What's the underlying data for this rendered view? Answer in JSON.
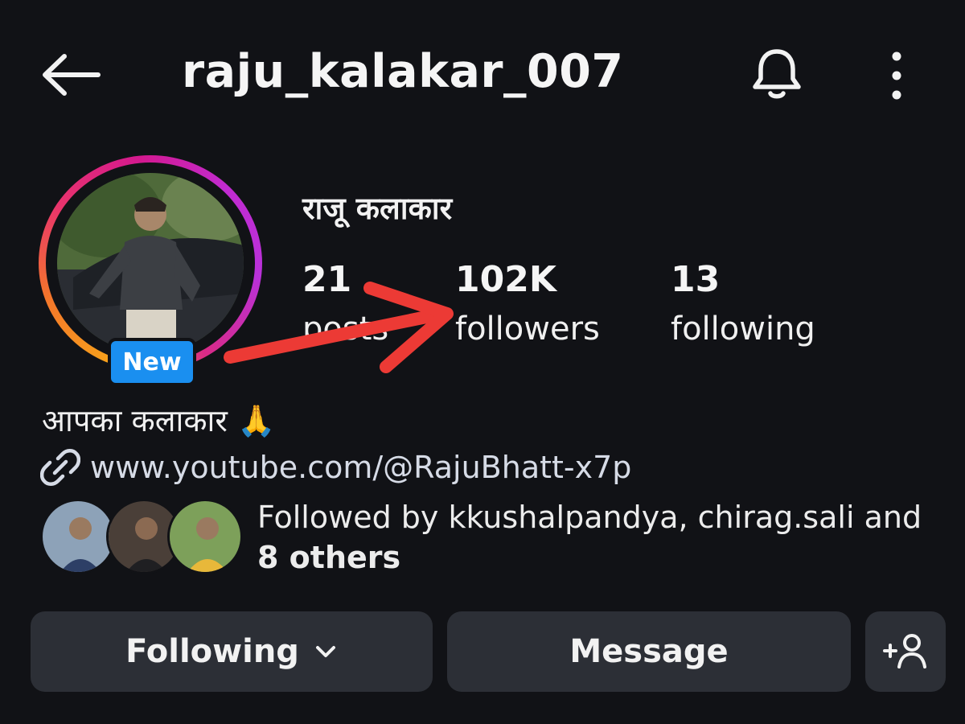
{
  "header": {
    "username": "raju_kalakar_007",
    "back_icon": "arrow-left-icon",
    "bell_icon": "bell-icon",
    "more_icon": "more-vertical-icon"
  },
  "profile": {
    "display_name": "राजू कलाकार",
    "badge": "New",
    "stats": {
      "posts": {
        "count": "21",
        "label": "posts"
      },
      "followers": {
        "count": "102K",
        "label": "followers"
      },
      "following": {
        "count": "13",
        "label": "following"
      }
    },
    "bio": "आपका कलाकार 🙏",
    "link": "www.youtube.com/@RajuBhatt-x7p",
    "followed_by": {
      "prefix": "Followed by kkushalpandya, chirag.sali and ",
      "others": "8 others"
    }
  },
  "actions": {
    "following": "Following",
    "message": "Message",
    "suggest_icon": "add-person-icon"
  },
  "colors": {
    "background": "#111216",
    "button": "#2c2f36",
    "badge": "#1a8ff0",
    "annotation_arrow": "#ec3a35"
  }
}
